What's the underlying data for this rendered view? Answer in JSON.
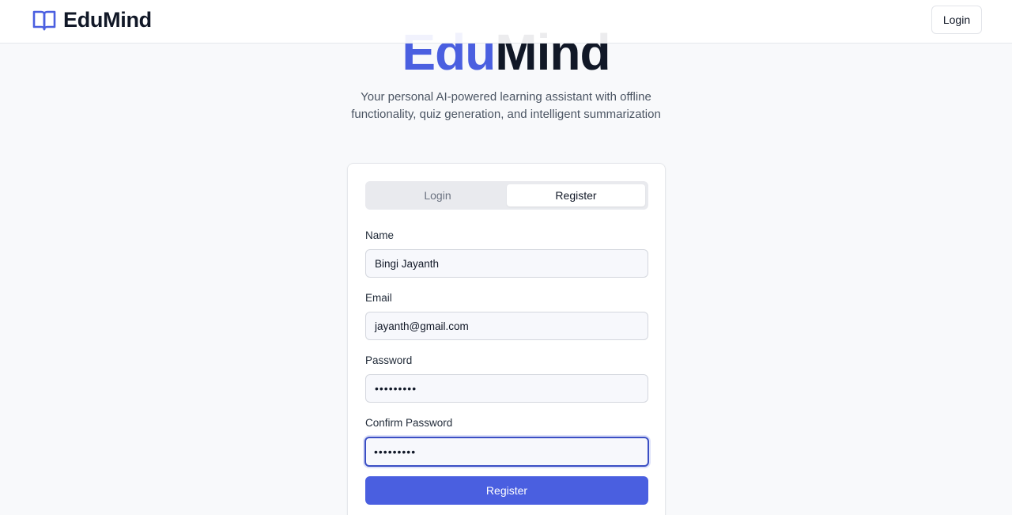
{
  "navbar": {
    "brand": "EduMind",
    "brand_icon": "open-book-icon",
    "login_label": "Login"
  },
  "hero": {
    "title_part1": "Edu",
    "title_part2": "Mind",
    "subtitle": "Your personal AI-powered learning assistant with offline functionality, quiz generation, and intelligent summarization"
  },
  "auth": {
    "tabs": [
      {
        "label": "Login",
        "active": false
      },
      {
        "label": "Register",
        "active": true
      }
    ],
    "fields": {
      "name": {
        "label": "Name",
        "value": "Bingi Jayanth"
      },
      "email": {
        "label": "Email",
        "value": "jayanth@gmail.com"
      },
      "password": {
        "label": "Password",
        "value": "•••••••••"
      },
      "confirm_password": {
        "label": "Confirm Password",
        "value": "•••••••••"
      }
    },
    "submit_label": "Register"
  },
  "colors": {
    "accent": "#4a5fe0",
    "text_dark": "#111827",
    "background": "#f8f9fb"
  }
}
